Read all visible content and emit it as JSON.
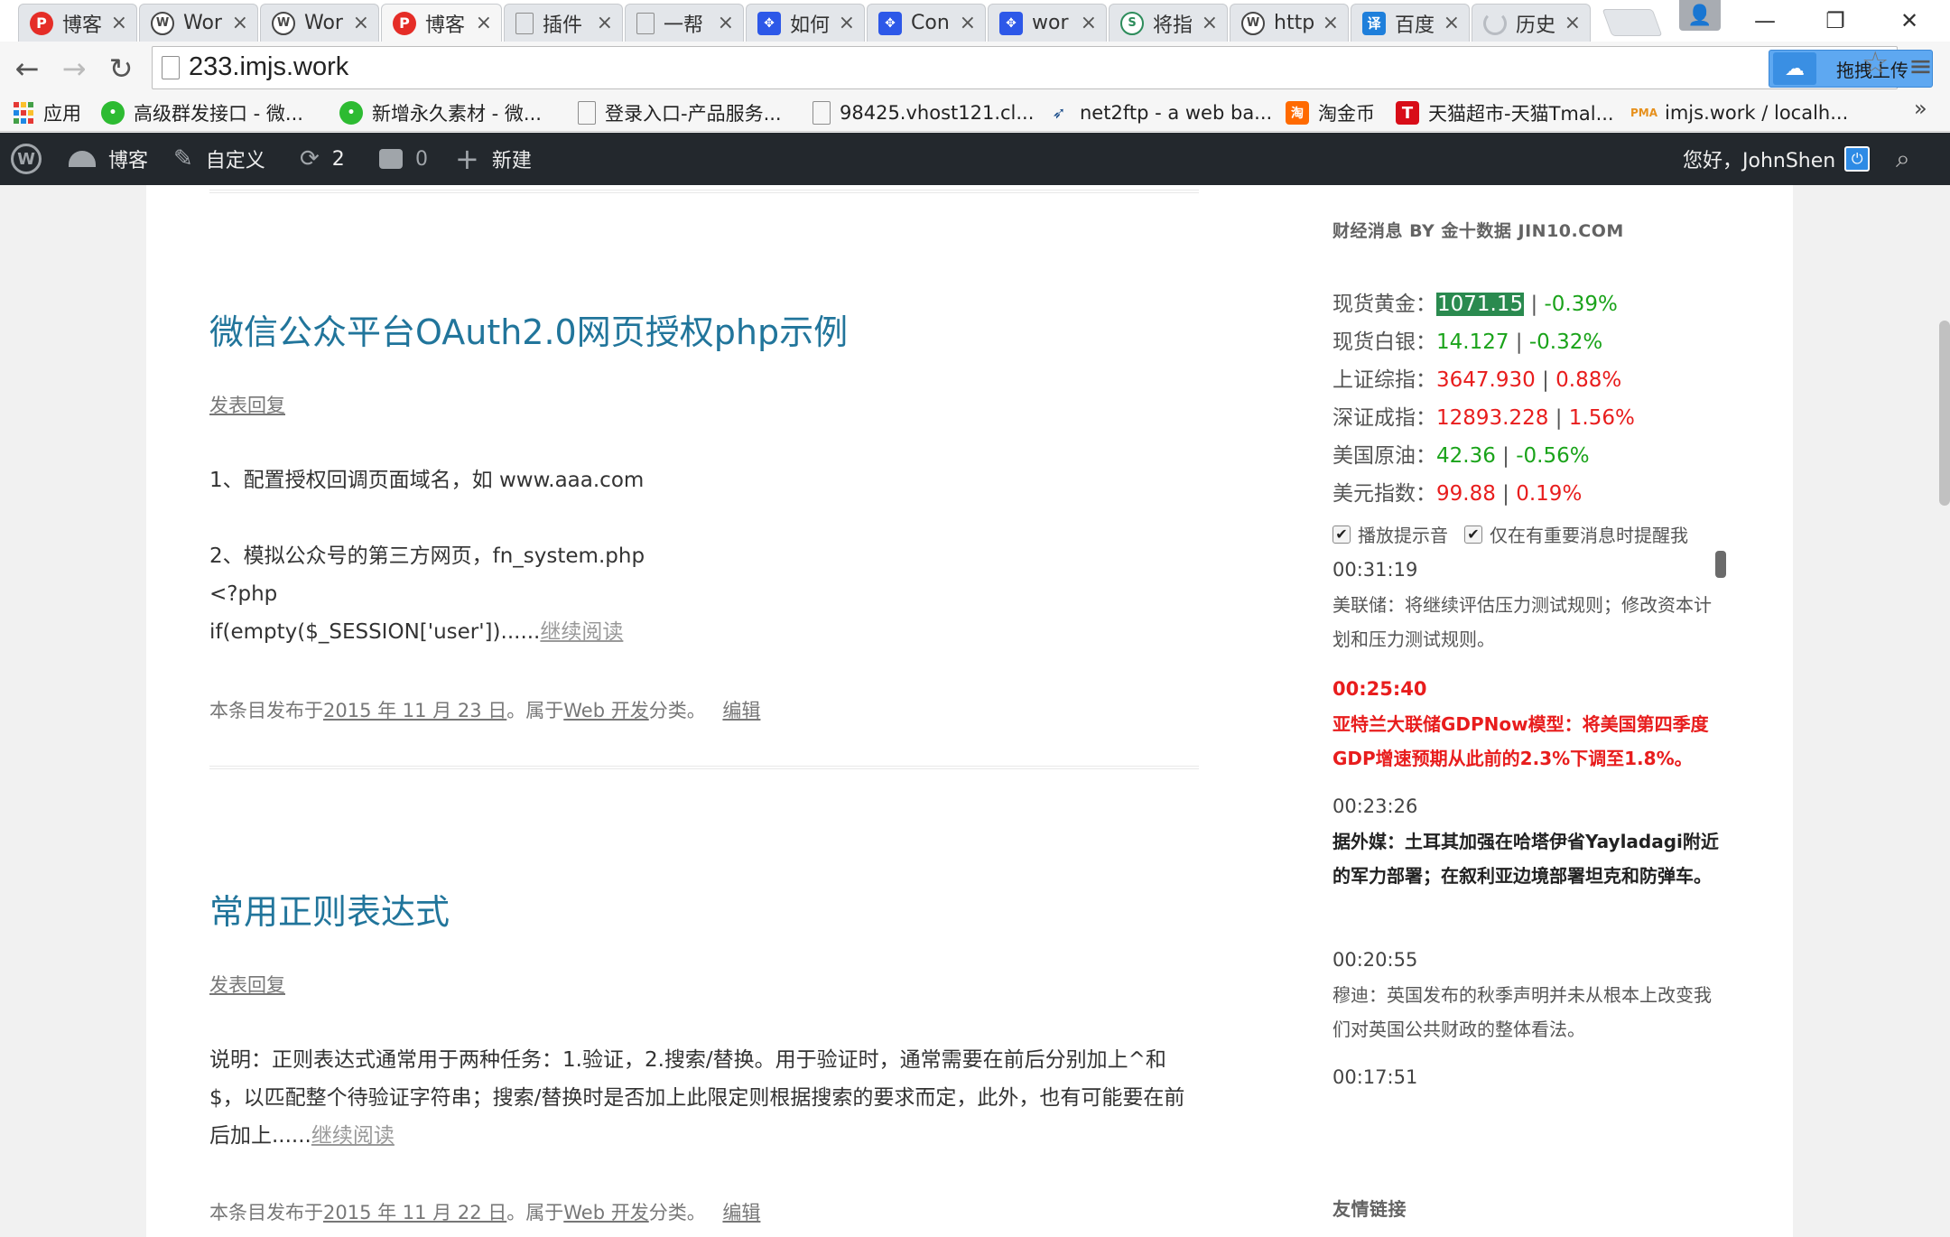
{
  "tabs": [
    {
      "title": "博客",
      "icon": "pocket-icon"
    },
    {
      "title": "Wor",
      "icon": "wordpress-icon"
    },
    {
      "title": "Wor",
      "icon": "wordpress-icon"
    },
    {
      "title": "博客",
      "icon": "pocket-icon"
    },
    {
      "title": "插件",
      "icon": "page-icon"
    },
    {
      "title": "一帮",
      "icon": "page-icon"
    },
    {
      "title": "如何",
      "icon": "baidu-paw-icon"
    },
    {
      "title": "Con",
      "icon": "baidu-paw-icon"
    },
    {
      "title": "wor",
      "icon": "baidu-paw-icon"
    },
    {
      "title": "将指",
      "icon": "segmentfault-icon"
    },
    {
      "title": "http",
      "icon": "wordpress-icon"
    },
    {
      "title": "百度",
      "icon": "translate-icon"
    },
    {
      "title": "历史",
      "icon": "loading-icon"
    }
  ],
  "toolbar": {
    "url": "233.imjs.work",
    "upload_label": "拖拽上传"
  },
  "bookmarks": [
    {
      "label": "应用",
      "icon": "apps-icon"
    },
    {
      "label": "高级群发接口 - 微...",
      "icon": "wechat-icon"
    },
    {
      "label": "新增永久素材 - 微...",
      "icon": "wechat-icon"
    },
    {
      "label": "登录入口-产品服务...",
      "icon": "page-icon"
    },
    {
      "label": "98425.vhost121.cl...",
      "icon": "page-icon"
    },
    {
      "label": "net2ftp - a web ba...",
      "icon": "net2ftp-icon"
    },
    {
      "label": "淘金币",
      "icon": "taobao-icon"
    },
    {
      "label": "天猫超市-天猫Tmal...",
      "icon": "tmall-icon"
    },
    {
      "label": "imjs.work / localh...",
      "icon": "phpmyadmin-icon"
    }
  ],
  "adminbar": {
    "blog": "博客",
    "customize": "自定义",
    "updates_count": "2",
    "comments_count": "0",
    "new": "新建",
    "greeting": "您好，JohnShen"
  },
  "posts": [
    {
      "title": "微信公众平台OAuth2.0网页授权php示例",
      "reply": "发表回复",
      "lines": [
        "1、配置授权回调页面域名，如 www.aaa.com",
        "2、模拟公众号的第三方网页，fn_system.php",
        "<?php",
        "if(empty($_SESSION['user'])......"
      ],
      "more": "继续阅读",
      "meta_prefix": "本条目发布于",
      "date": "2015 年 11 月 23 日",
      "meta_mid": "。属于",
      "category": "Web 开发",
      "meta_suffix": "分类。",
      "edit": "编辑"
    },
    {
      "title": "常用正则表达式",
      "reply": "发表回复",
      "lines": [
        "说明：正则表达式通常用于两种任务：1.验证，2.搜索/替换。用于验证时，通常需要在前后分别加上^和$，以匹配整个待验证字符串；搜索/替换时是否加上此限定则根据搜索的要求而定，此外，也有可能要在前后加上......"
      ],
      "more": "继续阅读",
      "meta_prefix": "本条目发布于",
      "date": "2015 年 11 月 22 日",
      "meta_mid": "。属于",
      "category": "Web 开发",
      "meta_suffix": "分类。",
      "edit": "编辑"
    }
  ],
  "sidebar": {
    "widget_title": "财经消息 BY 金十数据 JIN10.COM",
    "quotes": [
      {
        "label": "现货黄金：",
        "value": "1071.15",
        "change": "-0.39%",
        "trend": "down"
      },
      {
        "label": "现货白银：",
        "value": "14.127",
        "change": "-0.32%",
        "trend": "down"
      },
      {
        "label": "上证综指：",
        "value": "3647.930",
        "change": "0.88%",
        "trend": "up"
      },
      {
        "label": "深证成指：",
        "value": "12893.228",
        "change": "1.56%",
        "trend": "up"
      },
      {
        "label": "美国原油：",
        "value": "42.36",
        "change": "-0.56%",
        "trend": "down"
      },
      {
        "label": "美元指数：",
        "value": "99.88",
        "change": "0.19%",
        "trend": "up"
      }
    ],
    "sep": "|",
    "checkbox_sound": "播放提示音",
    "checkbox_important": "仅在有重要消息时提醒我",
    "news": [
      {
        "time": "00:31:19",
        "text": "美联储：将继续评估压力测试规则；修改资本计划和压力测试规则。",
        "style": "normal"
      },
      {
        "time": "00:25:40",
        "text": "亚特兰大联储GDPNow模型：将美国第四季度GDP增速预期从此前的2.3%下调至1.8%。",
        "style": "red"
      },
      {
        "time": "00:23:26",
        "text": "据外媒：土耳其加强在哈塔伊省Yayladagi附近的军力部署；在叙利亚边境部署坦克和防弹车。",
        "style": "dark"
      },
      {
        "time": "00:20:55",
        "text": "穆迪：英国发布的秋季声明并未从根本上改变我们对英国公共财政的整体看法。",
        "style": "normal"
      },
      {
        "time": "00:17:51",
        "text": "",
        "style": "normal"
      }
    ],
    "links_title": "友情链接"
  }
}
